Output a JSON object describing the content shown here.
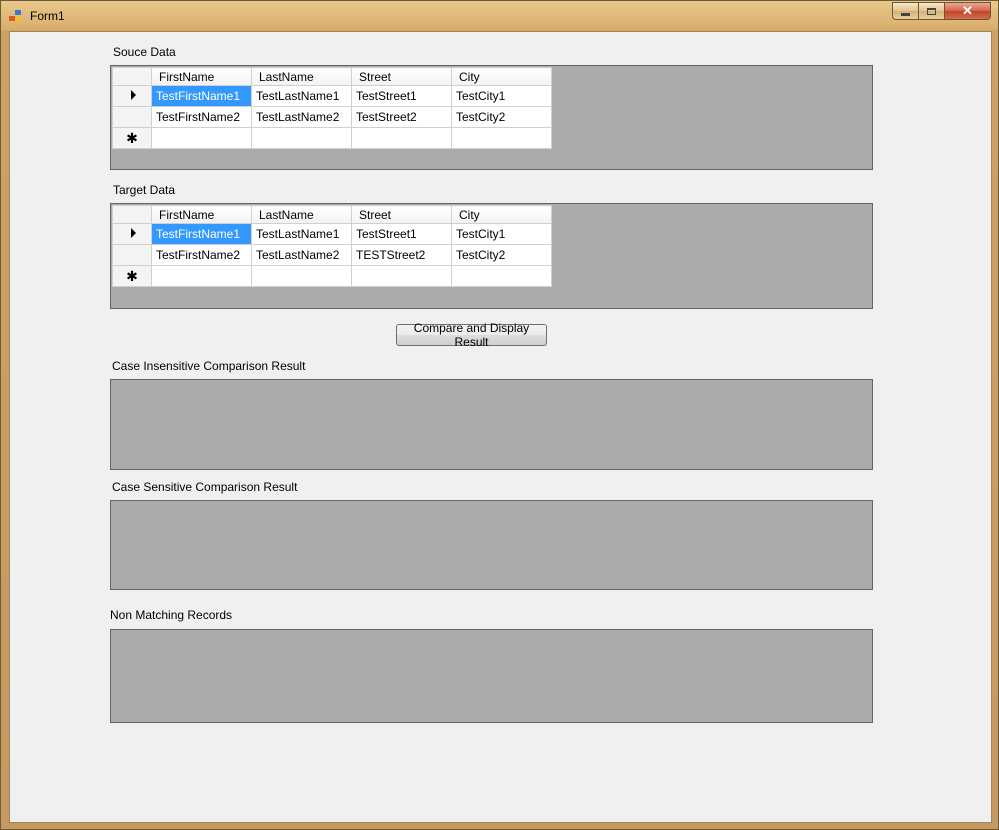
{
  "window": {
    "title": "Form1"
  },
  "source": {
    "label": "Souce Data",
    "columns": [
      "FirstName",
      "LastName",
      "Street",
      "City"
    ],
    "rows": [
      [
        "TestFirstName1",
        "TestLastName1",
        "TestStreet1",
        "TestCity1"
      ],
      [
        "TestFirstName2",
        "TestLastName2",
        "TestStreet2",
        "TestCity2"
      ]
    ],
    "new_row_marker": "✱"
  },
  "target": {
    "label": "Target Data",
    "columns": [
      "FirstName",
      "LastName",
      "Street",
      "City"
    ],
    "rows": [
      [
        "TestFirstName1",
        "TestLastName1",
        "TestStreet1",
        "TestCity1"
      ],
      [
        "TestFirstName2",
        "TestLastName2",
        "TESTStreet2",
        "TestCity2"
      ]
    ],
    "new_row_marker": "✱"
  },
  "compare_button": {
    "label": "Compare and Display Result"
  },
  "results": {
    "case_insensitive_label": "Case Insensitive Comparison Result",
    "case_sensitive_label": "Case Sensitive Comparison Result",
    "non_matching_label": "Non Matching Records"
  },
  "colors": {
    "selection": "#3399ff",
    "grid_background": "#ababab",
    "form_background": "#f0f0f0"
  }
}
